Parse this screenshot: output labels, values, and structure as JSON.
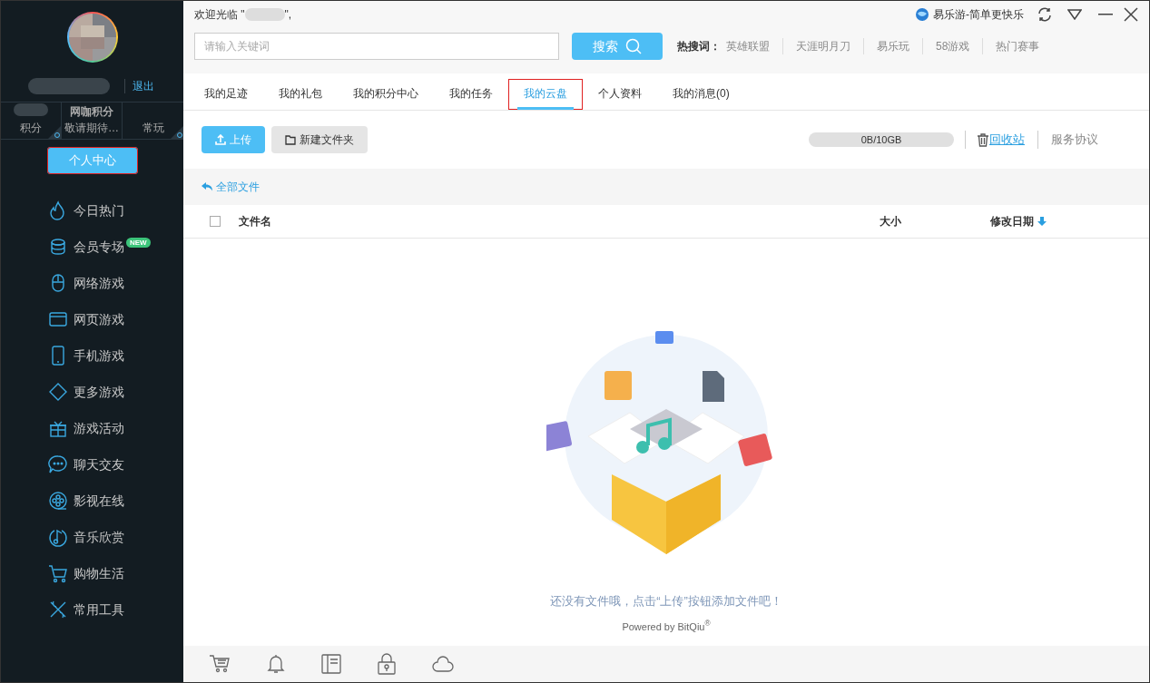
{
  "sidebar": {
    "logout": "退出",
    "stats": [
      {
        "label": "积分"
      },
      {
        "title": "网咖积分",
        "label": "敬请期待…"
      },
      {
        "label": "常玩"
      }
    ],
    "center_button": {
      "label": "个人中心",
      "annotated": true
    },
    "items": [
      {
        "label": "今日热门"
      },
      {
        "label": "会员专场",
        "badge": "NEW"
      },
      {
        "label": "网络游戏"
      },
      {
        "label": "网页游戏"
      },
      {
        "label": "手机游戏"
      },
      {
        "label": "更多游戏"
      },
      {
        "label": "游戏活动"
      },
      {
        "label": "聊天交友"
      },
      {
        "label": "影视在线"
      },
      {
        "label": "音乐欣赏"
      },
      {
        "label": "购物生活"
      },
      {
        "label": "常用工具"
      }
    ]
  },
  "header": {
    "welcome_prefix": "欢迎光临 \"",
    "welcome_suffix": "\",",
    "brand": "易乐游-简单更快乐",
    "search": {
      "placeholder": "请输入关键词",
      "button": "搜索"
    },
    "hot_label": "热搜词：",
    "hot_words": [
      "英雄联盟",
      "天涯明月刀",
      "易乐玩",
      "58游戏",
      "热门赛事"
    ]
  },
  "tabs": [
    {
      "label": "我的足迹",
      "selected": false,
      "annotated": false
    },
    {
      "label": "我的礼包",
      "selected": false,
      "annotated": false
    },
    {
      "label": "我的积分中心",
      "selected": false,
      "annotated": false
    },
    {
      "label": "我的任务",
      "selected": false,
      "annotated": false
    },
    {
      "label": "我的云盘",
      "selected": true,
      "annotated": true
    },
    {
      "label": "个人资料",
      "selected": false,
      "annotated": false
    },
    {
      "label": "我的消息(0)",
      "selected": false,
      "annotated": false
    }
  ],
  "toolbar": {
    "upload": "上传",
    "new_folder": "新建文件夹",
    "storage": {
      "text": "0B/10GB",
      "level": 0
    },
    "recycle": "回收站",
    "terms": "服务协议"
  },
  "breadcrumb": "全部文件",
  "table": {
    "select_all": {
      "checked": false
    },
    "columns": [
      "文件名",
      "大小",
      "修改日期"
    ]
  },
  "empty": {
    "message": "还没有文件哦，点击“上传”按钮添加文件吧！",
    "powered": "Powered by BitQiu$^{®}$"
  }
}
